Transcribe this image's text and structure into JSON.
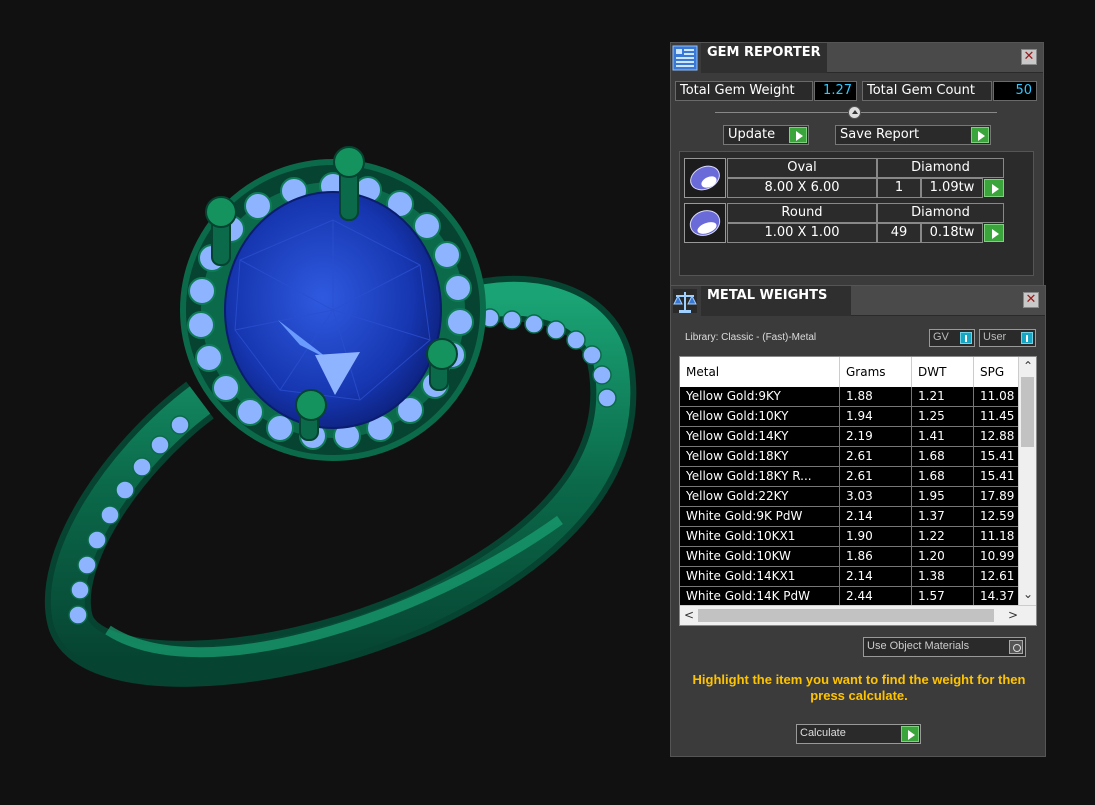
{
  "gem_reporter": {
    "title": "GEM REPORTER",
    "total_weight_label": "Total Gem Weight",
    "total_weight_value": "1.27",
    "total_count_label": "Total Gem Count",
    "total_count_value": "50",
    "update_label": "Update",
    "save_report_label": "Save Report",
    "gems": [
      {
        "shape": "Oval",
        "material": "Diamond",
        "size": "8.00 X 6.00",
        "count": "1",
        "weight": "1.09tw"
      },
      {
        "shape": "Round",
        "material": "Diamond",
        "size": "1.00 X 1.00",
        "count": "49",
        "weight": "0.18tw"
      }
    ]
  },
  "metal_weights": {
    "title": "METAL WEIGHTS",
    "library_label": "Library: Classic - (Fast)-Metal",
    "gv_label": "GV",
    "user_label": "User",
    "columns": [
      "Metal",
      "Grams",
      "DWT",
      "SPG"
    ],
    "rows": [
      [
        "Yellow Gold:9KY",
        "1.88",
        "1.21",
        "11.08"
      ],
      [
        "Yellow Gold:10KY",
        "1.94",
        "1.25",
        "11.45"
      ],
      [
        "Yellow Gold:14KY",
        "2.19",
        "1.41",
        "12.88"
      ],
      [
        "Yellow Gold:18KY",
        "2.61",
        "1.68",
        "15.41"
      ],
      [
        "Yellow Gold:18KY R...",
        "2.61",
        "1.68",
        "15.41"
      ],
      [
        "Yellow Gold:22KY",
        "3.03",
        "1.95",
        "17.89"
      ],
      [
        "White Gold:9K PdW",
        "2.14",
        "1.37",
        "12.59"
      ],
      [
        "White Gold:10KX1",
        "1.90",
        "1.22",
        "11.18"
      ],
      [
        "White Gold:10KW",
        "1.86",
        "1.20",
        "10.99"
      ],
      [
        "White Gold:14KX1",
        "2.14",
        "1.38",
        "12.61"
      ],
      [
        "White Gold:14K PdW",
        "2.44",
        "1.57",
        "14.37"
      ]
    ],
    "use_object_materials_label": "Use Object Materials",
    "hint_text": "Highlight the item you want to find the weight for then press calculate.",
    "calculate_label": "Calculate"
  },
  "colors": {
    "background": "#111111",
    "metal_green": "#0b6a4a",
    "sapphire": "#1a3fb8",
    "accent_cyan": "#2ec7ff",
    "hint_yellow": "#ffc400",
    "play_green": "#3aa53a"
  }
}
